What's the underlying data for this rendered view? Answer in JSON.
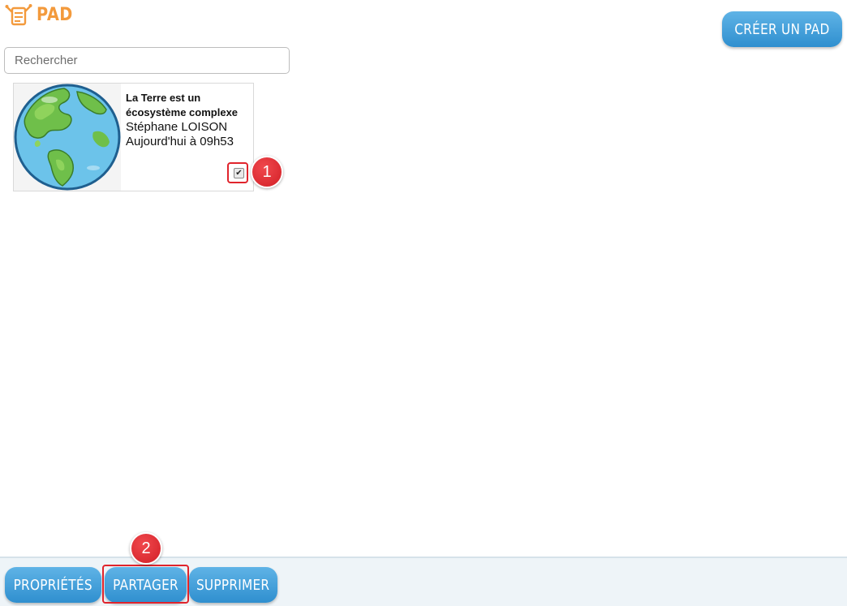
{
  "header": {
    "app_title": "PAD",
    "create_button_label": "CRÉER UN PAD"
  },
  "search": {
    "placeholder": "Rechercher",
    "value": ""
  },
  "pads": [
    {
      "title": "La Terre est un écosystème complexe",
      "author": "Stéphane LOISON",
      "date": "Aujourd'hui à 09h53",
      "checked": true,
      "thumbnail_icon": "earth-icon"
    }
  ],
  "annotations": {
    "step1": "1",
    "step2": "2"
  },
  "bottom_bar": {
    "properties_label": "PROPRIÉTÉS",
    "share_label": "PARTAGER",
    "delete_label": "SUPPRIMER"
  },
  "colors": {
    "brand_orange": "#f39a3c",
    "button_blue": "#3a9ad8",
    "annotation_red": "#e0242c"
  }
}
